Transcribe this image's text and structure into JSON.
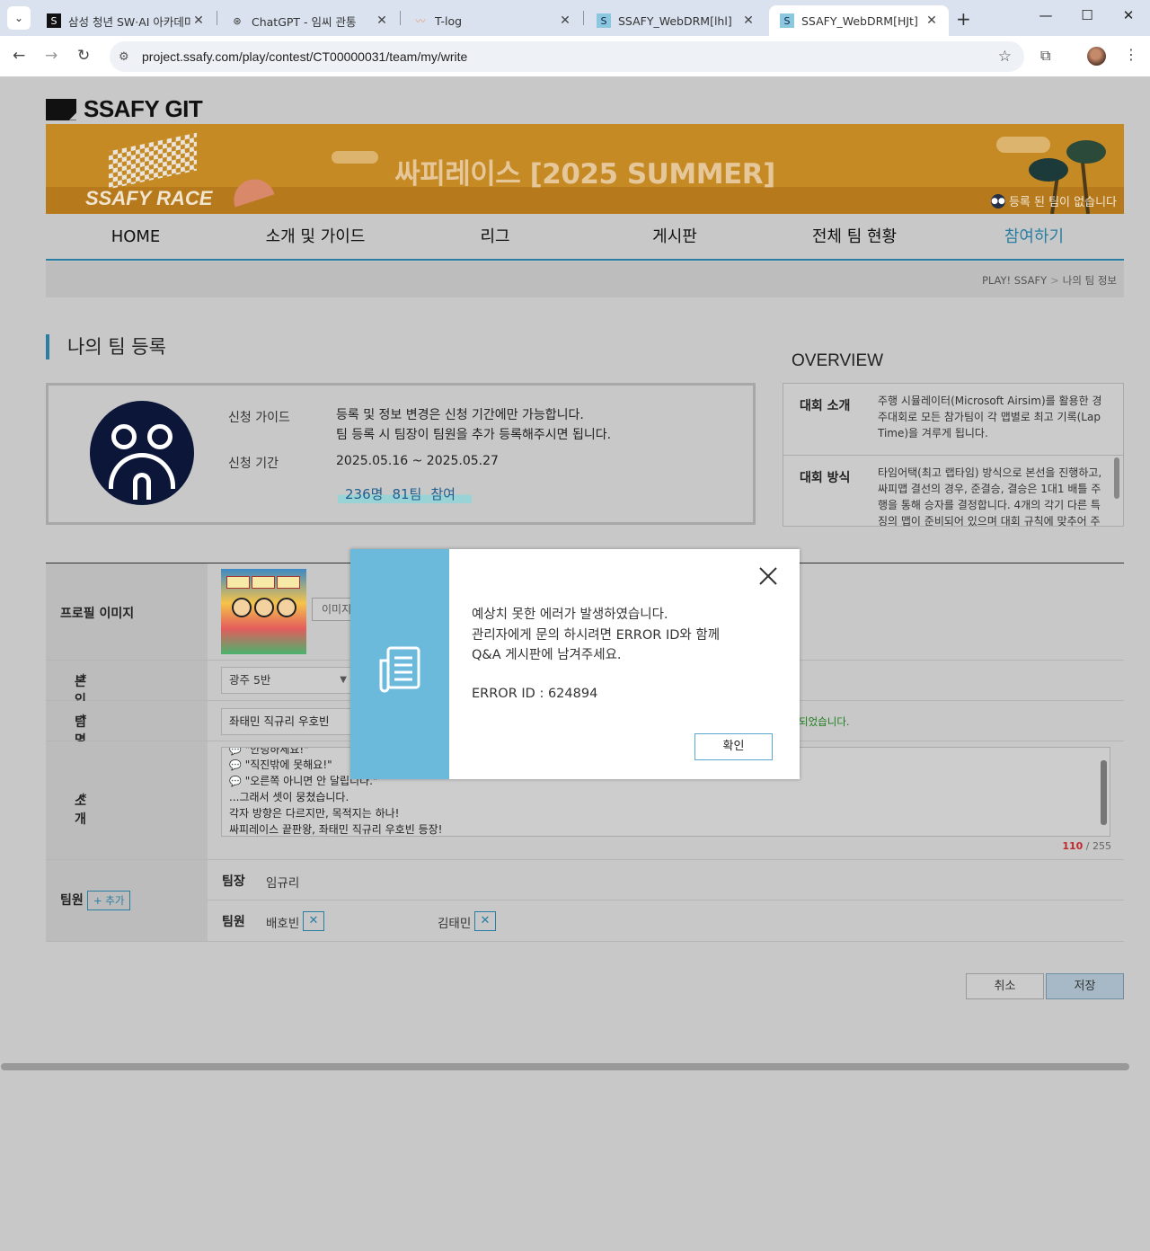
{
  "browser": {
    "tabs": [
      {
        "title": "삼성 청년 SW·AI 아카데미",
        "active": false
      },
      {
        "title": "ChatGPT - 임씨 관통",
        "active": false
      },
      {
        "title": "T-log",
        "active": false
      },
      {
        "title": "SSAFY_WebDRM[lhl]",
        "active": false
      },
      {
        "title": "SSAFY_WebDRM[HJt]",
        "active": true
      }
    ],
    "url": "project.ssafy.com/play/contest/CT00000031/team/my/write"
  },
  "site": {
    "logo": "SSAFY GIT",
    "banner_title": "싸피레이스 [2025 SUMMER]",
    "banner_brand": "SSAFY RACE",
    "banner_note": "등록 된 팀이 없습니다"
  },
  "nav": [
    {
      "label": "HOME"
    },
    {
      "label": "소개 및 가이드"
    },
    {
      "label": "리그"
    },
    {
      "label": "게시판"
    },
    {
      "label": "전체 팀 현황"
    },
    {
      "label": "참여하기"
    }
  ],
  "breadcrumb": {
    "root": "PLAY! SSAFY",
    "current": "나의 팀 정보"
  },
  "page_title": "나의 팀 등록",
  "guide": {
    "guide_label": "신청 가이드",
    "guide_line1": "등록 및 정보 변경은 신청 기간에만 가능합니다.",
    "guide_line2": "팀 등록 시 팀장이 팀원을 추가 등록해주시면 됩니다.",
    "period_label": "신청 기간",
    "period_value": "2025.05.16 ~ 2025.05.27",
    "stat_people": "236명",
    "stat_teams": "81팀",
    "stat_join": "참여"
  },
  "overview": {
    "title": "OVERVIEW",
    "rows": [
      {
        "label": "대회 소개",
        "text": "주행 시뮬레이터(Microsoft Airsim)를 활용한 경주대회로 모든 참가팀이 각 맵별로 최고 기록(Lap Time)을 겨루게 됩니다."
      },
      {
        "label": "대회 방식",
        "text": "타임어택(최고 랩타임) 방식으로 본선을 진행하고, 싸피맵 결선의 경우, 준결승, 결승은 1대1 배틀 주행을 통해 승자를 결정합니다. 4개의 각기 다른 특징의 맵이 준비되어 있으며 대회 규칙에 맞추어 주행"
      }
    ]
  },
  "form": {
    "profile_label": "프로필 이미지",
    "image_button": "이미지",
    "class_label": "본인 분반",
    "class_value": "광주 5반",
    "team_label": "팀명",
    "team_value": "좌태민 직규리 우호빈",
    "team_ok": "되었습니다.",
    "intro_label": "소개",
    "intro_lines": [
      "\"안녕하세요!\"",
      "\"직진밖에 못해요!\"",
      "\"오른쪽 아니면 안 달립니다.\"",
      "...그래서 셋이 뭉쳤습니다.",
      "각자 방향은 다르지만, 목적지는 하나!",
      "싸피레이스 끝판왕, 좌태민 직규리 우호빈 등장!"
    ],
    "intro_count": "110",
    "intro_max": "/ 255",
    "members_label": "팀원",
    "add_label": "+ 추가",
    "leader_role": "팀장",
    "leader_name": "임규리",
    "member_role": "팀원",
    "member1": "배호빈",
    "member2": "김태민"
  },
  "buttons": {
    "cancel": "취소",
    "save": "저장"
  },
  "modal": {
    "line1": "예상치 못한 에러가 발생하였습니다.",
    "line2": "관리자에게 문의 하시려면 ERROR ID와 함께",
    "line3": "Q&A 게시판에 남겨주세요.",
    "error": "ERROR ID : 624894",
    "confirm": "확인"
  },
  "colors": {
    "accent": "#2a7ea3",
    "modal_side": "#6bbadc",
    "banner": "#c58a24"
  }
}
